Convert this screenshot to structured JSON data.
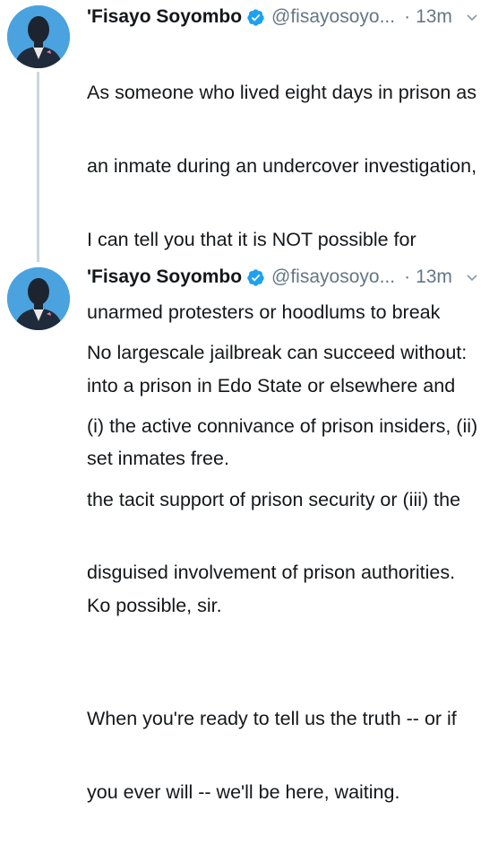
{
  "tweets": [
    {
      "display_name": "'Fisayo Soyombo",
      "handle": "@fisayosoyo...",
      "separator": "·",
      "time": "13m",
      "lines": [
        "As someone who lived eight days in prison as",
        "an inmate during an undercover investigation,",
        "I can tell you that it is NOT possible for",
        "unarmed protesters or hoodlums to break",
        "into a prison in Edo State or elsewhere and",
        "set inmates free."
      ],
      "lines2": [
        "Ko possible, sir."
      ]
    },
    {
      "display_name": "'Fisayo Soyombo",
      "handle": "@fisayosoyo...",
      "separator": "·",
      "time": "13m",
      "lines": [
        "No largescale jailbreak can succeed without:",
        "(i) the active connivance of prison insiders, (ii)",
        "the tacit support of prison security or (iii) the",
        "disguised involvement of prison authorities."
      ],
      "lines2": [
        "When you're ready to tell us the truth -- or if",
        "you ever will -- we'll be here, waiting."
      ]
    }
  ],
  "colors": {
    "avatar_bg": "#4aa3df",
    "verified": "#1da1f2",
    "muted_text": "#657786",
    "thread_line": "#ccd6dd"
  }
}
